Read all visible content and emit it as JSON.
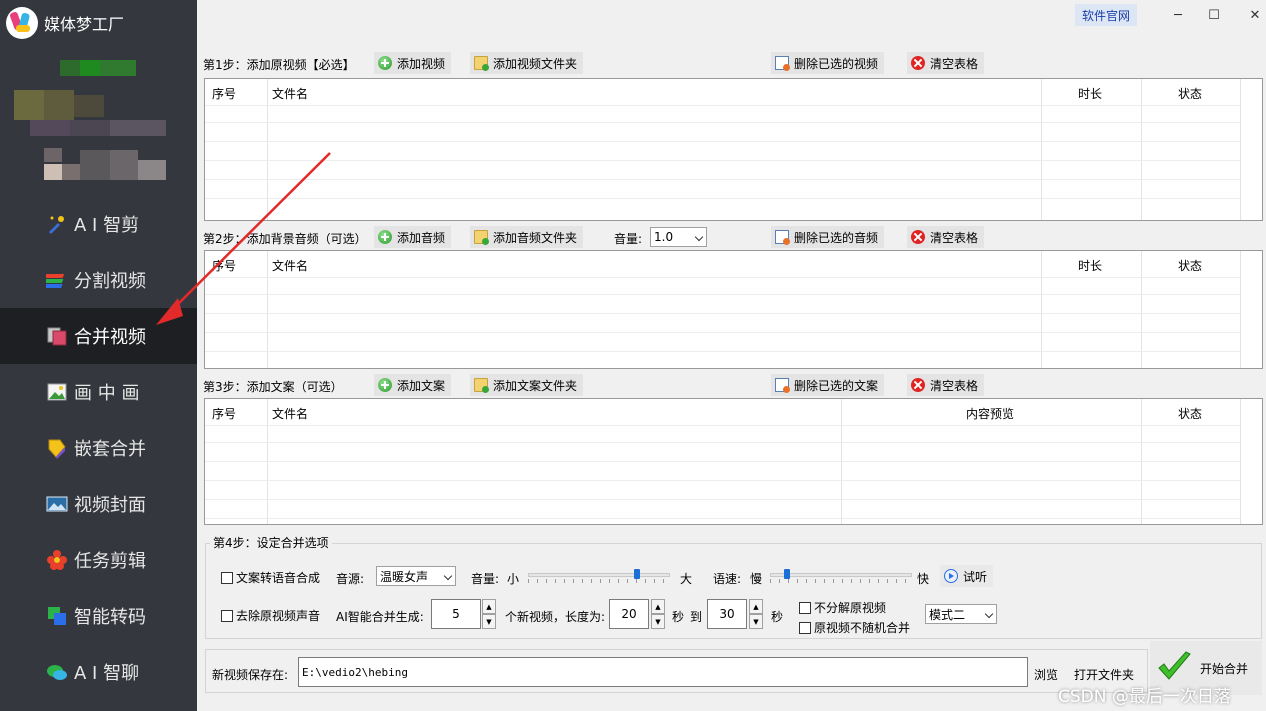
{
  "app": {
    "title": "媒体梦工厂"
  },
  "topbar": {
    "official_link": "软件官网",
    "min": "─",
    "max": "☐",
    "close": "✕"
  },
  "sidebar": {
    "items": [
      {
        "label": "A I 智剪",
        "icon": "ai-clip-icon",
        "active": false
      },
      {
        "label": "分割视频",
        "icon": "split-video-icon",
        "active": false
      },
      {
        "label": "合并视频",
        "icon": "merge-video-icon",
        "active": true
      },
      {
        "label": "画 中 画",
        "icon": "picture-in-picture-icon",
        "active": false
      },
      {
        "label": "嵌套合并",
        "icon": "nested-merge-icon",
        "active": false
      },
      {
        "label": "视频封面",
        "icon": "video-cover-icon",
        "active": false
      },
      {
        "label": "任务剪辑",
        "icon": "task-edit-icon",
        "active": false
      },
      {
        "label": "智能转码",
        "icon": "smart-transcode-icon",
        "active": false
      },
      {
        "label": "A I 智聊",
        "icon": "ai-chat-icon",
        "active": false
      }
    ]
  },
  "step1": {
    "label": "第1步：添加原视频【必选】",
    "add": "添加视频",
    "add_folder": "添加视频文件夹",
    "delete": "删除已选的视频",
    "clear": "清空表格",
    "columns": [
      "序号",
      "文件名",
      "时长",
      "状态"
    ]
  },
  "step2": {
    "label": "第2步：添加背景音频（可选）",
    "add": "添加音频",
    "add_folder": "添加音频文件夹",
    "volume_label": "音量:",
    "volume_value": "1.0",
    "delete": "删除已选的音频",
    "clear": "清空表格",
    "columns": [
      "序号",
      "文件名",
      "时长",
      "状态"
    ]
  },
  "step3": {
    "label": "第3步：添加文案（可选）",
    "add": "添加文案",
    "add_folder": "添加文案文件夹",
    "delete": "删除已选的文案",
    "clear": "清空表格",
    "columns": [
      "序号",
      "文件名",
      "内容预览",
      "状态"
    ]
  },
  "step4": {
    "label": "第4步：设定合并选项",
    "tts_checkbox": "文案转语音合成",
    "voice_label": "音源:",
    "voice_value": "温暖女声",
    "volume_label": "音量:",
    "volume_small": "小",
    "volume_large": "大",
    "volume_level": 0.78,
    "speed_label": "语速:",
    "speed_slow": "慢",
    "speed_fast": "快",
    "speed_level": 0.1,
    "preview": "试听",
    "remove_audio_checkbox": "去除原视频声音",
    "ai_gen_label": "AI智能合并生成:",
    "count_value": "5",
    "count_suffix": "个新视频，长度为:",
    "len_min": "20",
    "sec1": "秒",
    "to": "到",
    "len_max": "30",
    "sec2": "秒",
    "no_split_checkbox": "不分解原视频",
    "no_random_checkbox": "原视频不随机合并",
    "mode_value": "模式二"
  },
  "output": {
    "label": "新视频保存在:",
    "path": "E:\\vedio2\\hebing",
    "browse": "浏览",
    "open_folder": "打开文件夹",
    "start": "开始合并"
  },
  "watermark": "CSDN @最后一次日落"
}
